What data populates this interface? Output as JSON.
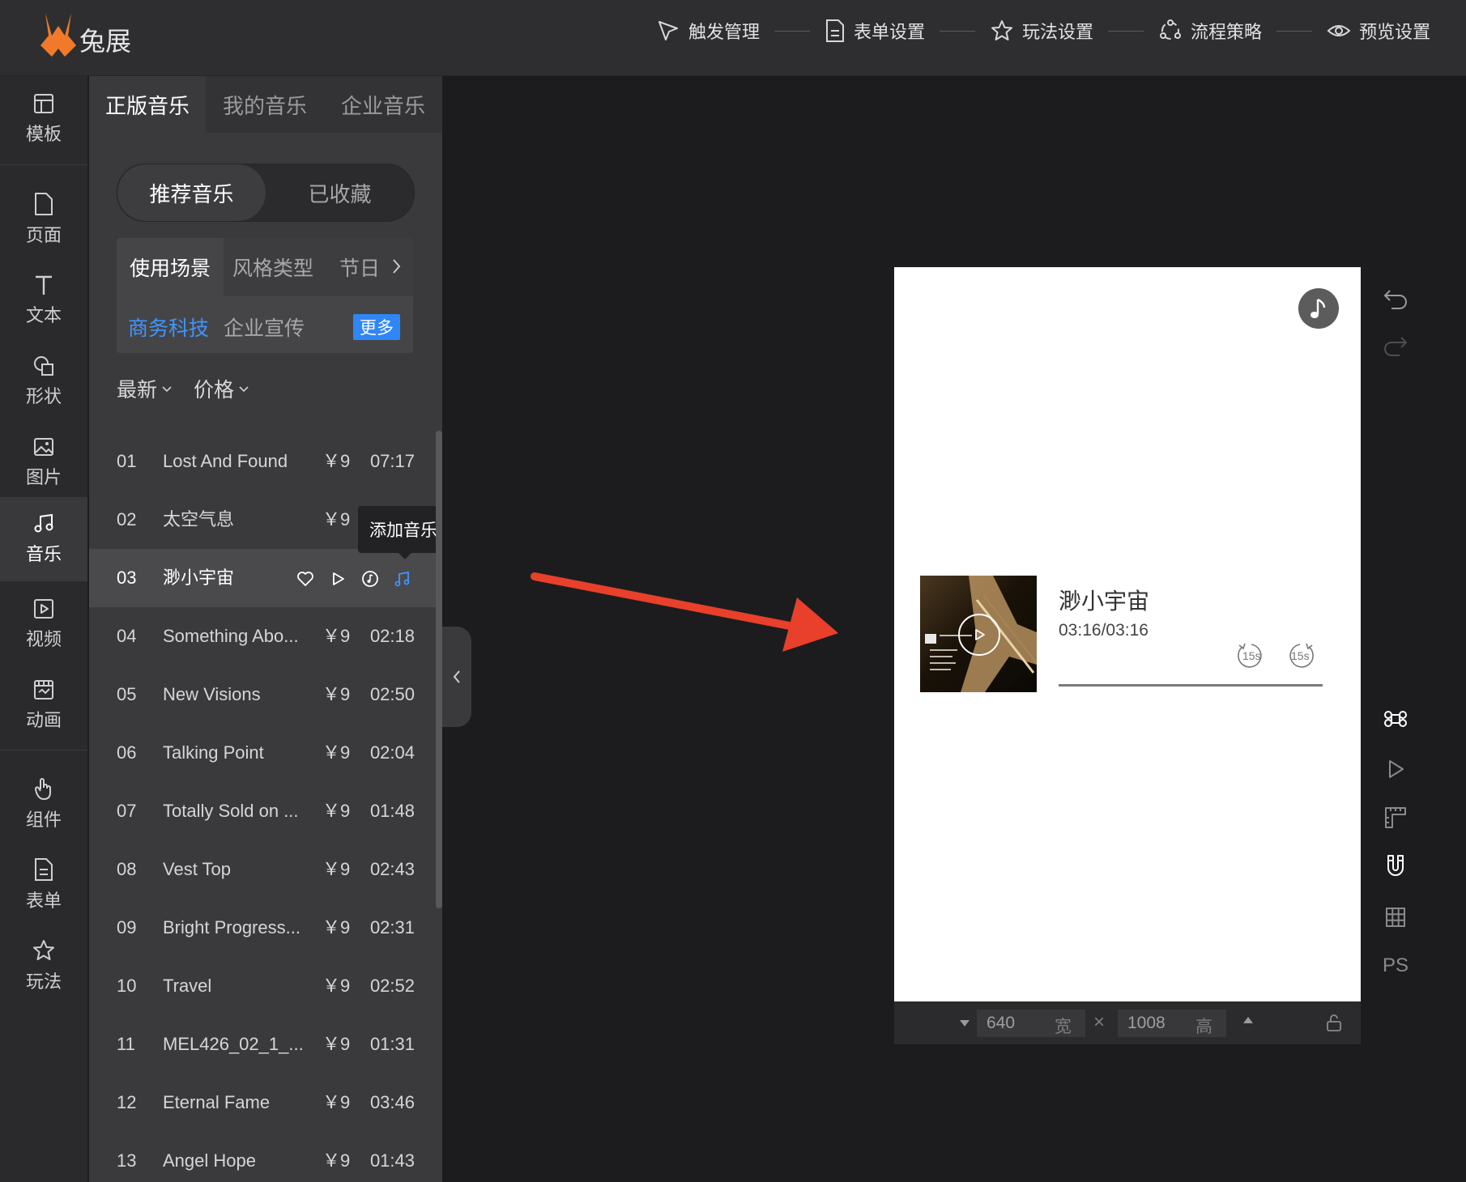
{
  "app": {
    "logo_text": "兔展",
    "brand_color": "#f07a2a"
  },
  "topbar": {
    "steps": [
      {
        "label": "触发管理",
        "icon": "pointer-icon"
      },
      {
        "label": "表单设置",
        "icon": "form-doc-icon"
      },
      {
        "label": "玩法设置",
        "icon": "star-icon"
      },
      {
        "label": "流程策略",
        "icon": "flow-icon"
      },
      {
        "label": "预览设置",
        "icon": "eye-icon"
      }
    ]
  },
  "rail": {
    "items": [
      {
        "label": "模板",
        "icon": "template-icon"
      },
      {
        "label": "页面",
        "icon": "page-icon"
      },
      {
        "label": "文本",
        "icon": "text-icon"
      },
      {
        "label": "形状",
        "icon": "shape-icon"
      },
      {
        "label": "图片",
        "icon": "image-icon"
      },
      {
        "label": "音乐",
        "icon": "music-icon",
        "active": true
      },
      {
        "label": "视频",
        "icon": "video-icon"
      },
      {
        "label": "动画",
        "icon": "animation-icon"
      },
      {
        "label": "组件",
        "icon": "hand-pointer-icon"
      },
      {
        "label": "表单",
        "icon": "form-icon"
      },
      {
        "label": "玩法",
        "icon": "star-icon"
      }
    ]
  },
  "panel": {
    "tabs": [
      "正版音乐",
      "我的音乐",
      "企业音乐"
    ],
    "segment": [
      "推荐音乐",
      "已收藏"
    ],
    "filter_tabs": [
      "使用场景",
      "风格类型",
      "节日"
    ],
    "tags": [
      "商务科技",
      "企业宣传"
    ],
    "more_label": "更多",
    "sorts": [
      "最新",
      "价格"
    ],
    "tooltip": "添加音乐",
    "tracks": [
      {
        "num": "01",
        "title": "Lost And Found",
        "price": "￥9",
        "duration": "07:17"
      },
      {
        "num": "02",
        "title": "太空气息",
        "price": "￥9",
        "duration": ""
      },
      {
        "num": "03",
        "title": "渺小宇宙",
        "price": "",
        "duration": "",
        "hovered": true
      },
      {
        "num": "04",
        "title": "Something Abo...",
        "price": "￥9",
        "duration": "02:18"
      },
      {
        "num": "05",
        "title": "New Visions",
        "price": "￥9",
        "duration": "02:50"
      },
      {
        "num": "06",
        "title": "Talking Point",
        "price": "￥9",
        "duration": "02:04"
      },
      {
        "num": "07",
        "title": "Totally Sold on ...",
        "price": "￥9",
        "duration": "01:48"
      },
      {
        "num": "08",
        "title": "Vest Top",
        "price": "￥9",
        "duration": "02:43"
      },
      {
        "num": "09",
        "title": "Bright Progress...",
        "price": "￥9",
        "duration": "02:31"
      },
      {
        "num": "10",
        "title": "Travel",
        "price": "￥9",
        "duration": "02:52"
      },
      {
        "num": "11",
        "title": "MEL426_02_1_...",
        "price": "￥9",
        "duration": "01:31"
      },
      {
        "num": "12",
        "title": "Eternal Fame",
        "price": "￥9",
        "duration": "03:46"
      },
      {
        "num": "13",
        "title": "Angel Hope",
        "price": "￥9",
        "duration": "01:43"
      }
    ]
  },
  "canvas": {
    "player": {
      "title": "渺小宇宙",
      "time_current": "03:16",
      "time_sep": "/",
      "time_total": "03:16",
      "skip_back_label": "15s",
      "skip_forward_label": "15s"
    },
    "size": {
      "width": "640",
      "width_unit": "宽",
      "height": "1008",
      "height_unit": "高",
      "times": "×"
    }
  },
  "toolbar": {
    "ps_label": "PS"
  },
  "colors": {
    "accent_blue": "#2f86f6",
    "annotation_red": "#e8402b"
  }
}
